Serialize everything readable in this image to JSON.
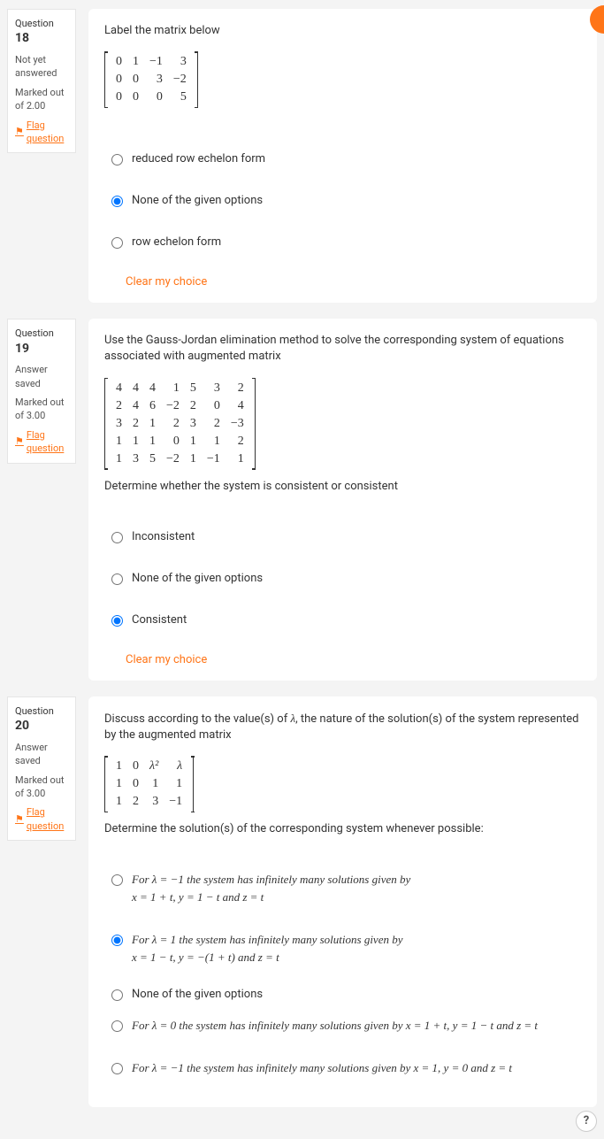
{
  "help_label": "?",
  "clear_choice_label": "Clear my choice",
  "flag_label": "Flag question",
  "q18": {
    "number_prefix": "Question ",
    "number": "18",
    "status": "Not yet answered",
    "marks": "Marked out of 2.00",
    "prompt": "Label the matrix below",
    "matrix": [
      [
        "0",
        "1",
        "−1",
        "3"
      ],
      [
        "0",
        "0",
        "3",
        "−2"
      ],
      [
        "0",
        "0",
        "0",
        "5"
      ]
    ],
    "options": {
      "a": "reduced row echelon form",
      "b": "None of the given options",
      "c": "row echelon form"
    }
  },
  "q19": {
    "number_prefix": "Question ",
    "number": "19",
    "status": "Answer saved",
    "marks": "Marked out of 3.00",
    "prompt": "Use the Gauss-Jordan elimination method to solve the corresponding system of equations associated with augmented matrix",
    "matrix": [
      [
        "4",
        "4",
        "4",
        "1",
        "5",
        "3",
        "2"
      ],
      [
        "2",
        "4",
        "6",
        "−2",
        "2",
        "0",
        "4"
      ],
      [
        "3",
        "2",
        "1",
        "2",
        "3",
        "2",
        "−3"
      ],
      [
        "1",
        "1",
        "1",
        "0",
        "1",
        "1",
        "2"
      ],
      [
        "1",
        "3",
        "5",
        "−2",
        "1",
        "−1",
        "1"
      ]
    ],
    "prompt2": "Determine whether the system is consistent or consistent",
    "options": {
      "a": "Inconsistent",
      "b": "None of the given options",
      "c": "Consistent"
    }
  },
  "q20": {
    "number_prefix": "Question ",
    "number": "20",
    "status": "Answer saved",
    "marks": "Marked out of 3.00",
    "prompt_a": "Discuss according to the value(s) of ",
    "prompt_b": ", the nature of the solution(s) of the system represented by the augmented matrix",
    "matrix": [
      [
        "1",
        "0",
        "λ²",
        "λ"
      ],
      [
        "1",
        "0",
        "1",
        "1"
      ],
      [
        "1",
        "2",
        "3",
        "−1"
      ]
    ],
    "prompt2": "Determine the solution(s) of the corresponding system whenever possible:",
    "options": {
      "a_line1": "For λ = −1 the system has infinitely many solutions given by",
      "a_line2": "x = 1 + t,  y = 1 − t and z = t",
      "b_line1": "For λ = 1 the system has infinitely many solutions given by",
      "b_line2": "x = 1 − t,  y = −(1 + t) and z = t",
      "c": "None of the given options",
      "d": "For λ = 0 the system has infinitely many solutions given by x = 1 + t,  y = 1 − t and z = t",
      "e": "For λ = −1 the system has infinitely many solutions given by x = 1,  y = 0 and z = t"
    }
  }
}
